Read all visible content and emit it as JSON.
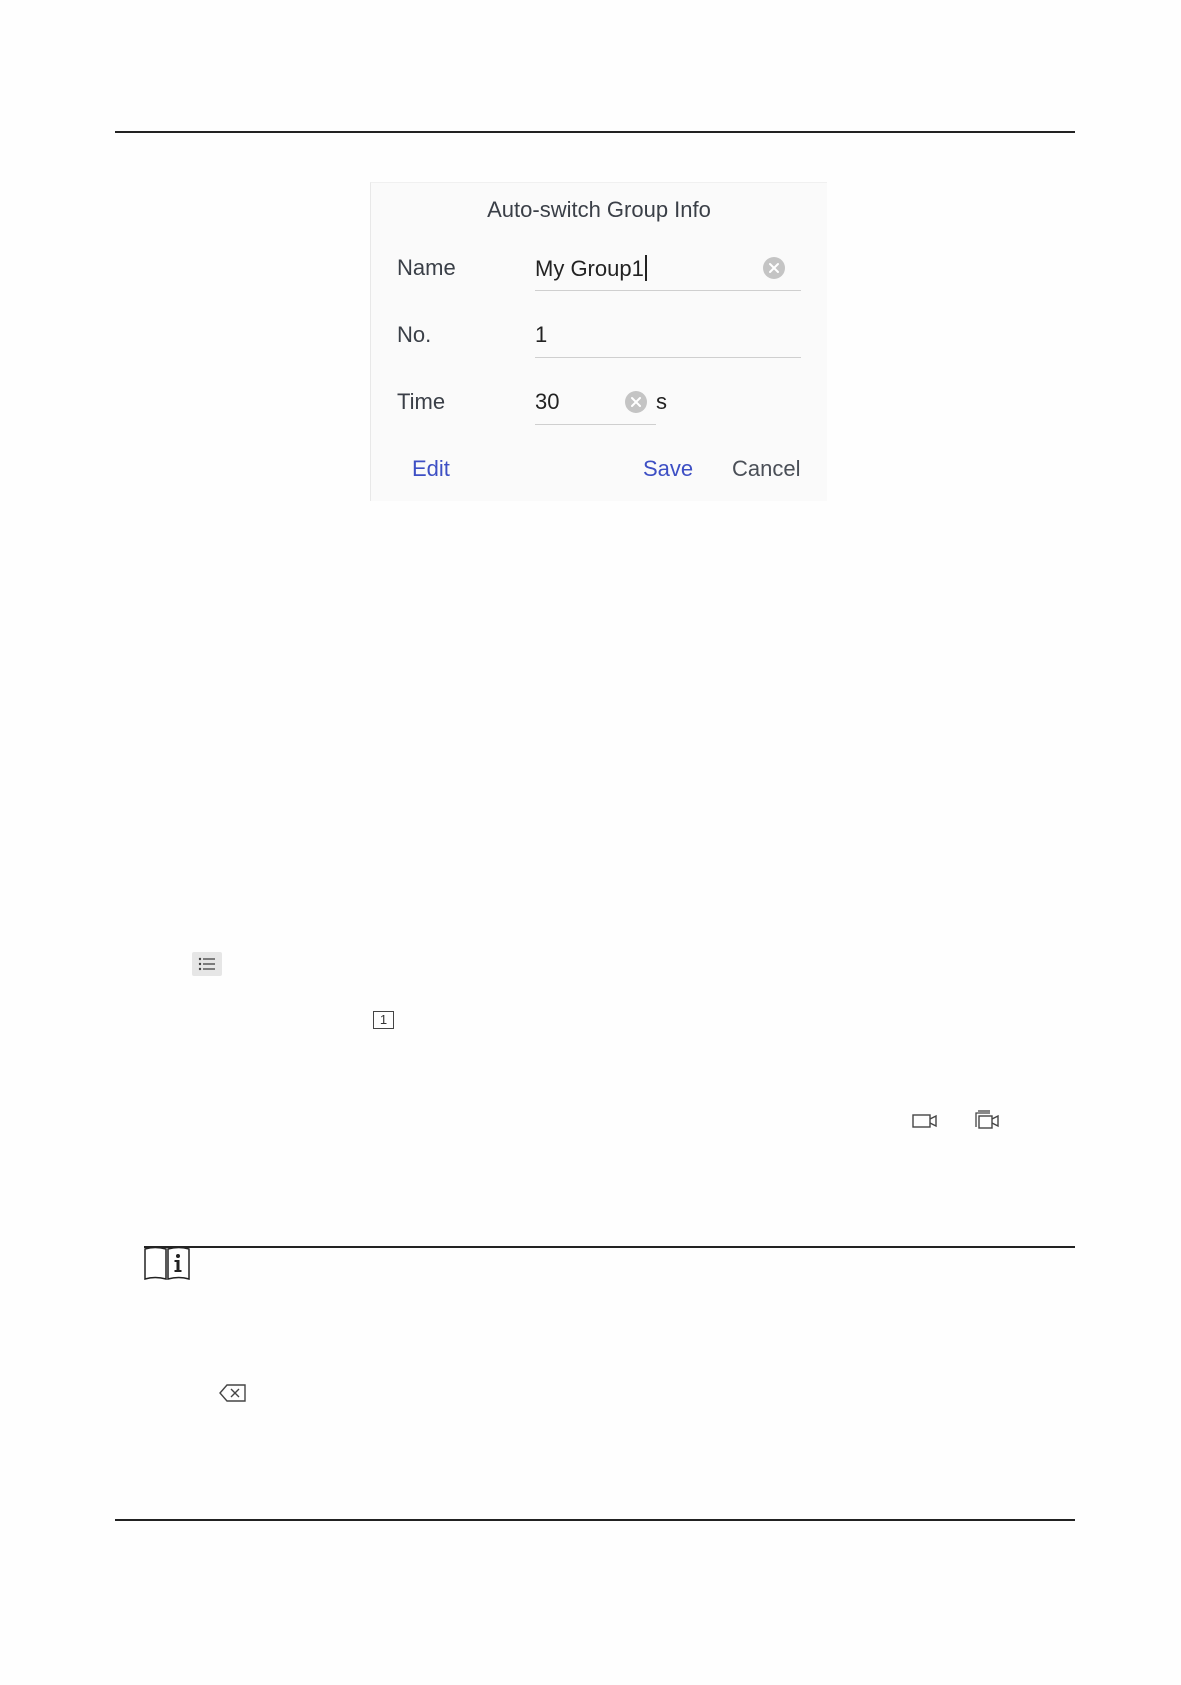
{
  "dialog": {
    "title": "Auto-switch Group Info",
    "fields": {
      "name": {
        "label": "Name",
        "value": "My Group1"
      },
      "no": {
        "label": "No.",
        "value": "1"
      },
      "time": {
        "label": "Time",
        "value": "30",
        "unit": "s"
      }
    },
    "buttons": {
      "edit": "Edit",
      "save": "Save",
      "cancel": "Cancel"
    }
  },
  "icons": {
    "list": "list-icon",
    "window_1": "1",
    "camera": "camera-icon",
    "multi_camera": "multi-camera-icon",
    "note": "note-book-icon",
    "backspace": "backspace-icon"
  },
  "colors": {
    "accent": "#3d4fc4",
    "text": "#3a3f47"
  }
}
